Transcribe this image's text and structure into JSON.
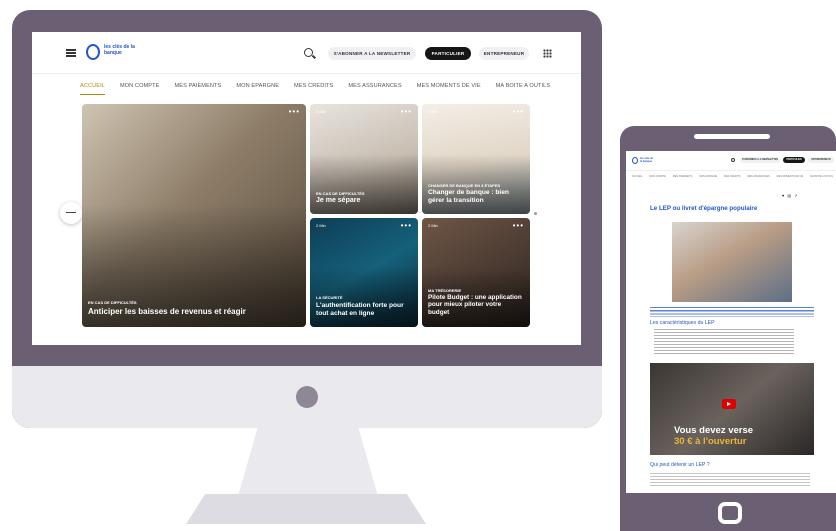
{
  "desktop": {
    "logo": {
      "text": "les clés de la banque"
    },
    "header": {
      "newsletter_label": "S'ABONNER A LA NEWSLETTER",
      "particulier_label": "PARTICULIER",
      "entrepreneur_label": "ENTREPRENEUR"
    },
    "nav": [
      "ACCUEIL",
      "MON COMPTE",
      "MES PAIEMENTS",
      "MON EPARGNE",
      "MES CREDITS",
      "MES ASSURANCES",
      "MES MOMENTS DE VIE",
      "MA BOITE A OUTILS"
    ],
    "cards": {
      "main": {
        "category": "EN CAS DE DIFFICULTÉS",
        "title": "Anticiper les baisses de revenus et réagir"
      },
      "c1": {
        "time": "6 Min",
        "category": "EN CAS DE DIFFICULTÉS",
        "title": "Je me sépare"
      },
      "c2": {
        "time": "2 Min",
        "category": "CHANGER DE BANQUE EN 3 ÉTAPES",
        "title": "Changer de banque : bien gérer la transition"
      },
      "c3": {
        "time": "2 Min",
        "category": "LA SÉCURITÉ",
        "title": "L'authentification forte pour tout achat en ligne"
      },
      "c4": {
        "time": "2 Min",
        "category": "MA TRÉSORERIE",
        "title": "Pilote Budget : une application pour mieux piloter votre budget"
      }
    },
    "menu_dots": "•••"
  },
  "mobile": {
    "logo": {
      "text": "les clés de la banque"
    },
    "header": {
      "newsletter_label": "S'ABONNER A LA NEWSLETTER",
      "particulier_label": "PARTICULIER",
      "entrepreneur_label": "ENTREPRENEUR"
    },
    "nav": [
      "ACCUEIL",
      "MON COMPTE",
      "MES PAIEMENTS",
      "MON EPARGNE",
      "MES CREDITS",
      "MES ASSURANCES",
      "MES MOMENTS DE VIE",
      "MA BOITE A OUTILS"
    ],
    "article": {
      "title": "Le LEP ou livret d'épargne populaire",
      "section_heading": "Les caractéristiques du LEP",
      "question_heading": "Qui peut détenir un LEP ?",
      "video_text_line1": "Vous devez verse",
      "video_text_line2": "30 € à l'ouvertur"
    }
  },
  "colors": {
    "device_frame": "#6a5f73",
    "brand_blue": "#2456c8",
    "nav_active": "#b48a14",
    "button_dark": "#161616"
  }
}
